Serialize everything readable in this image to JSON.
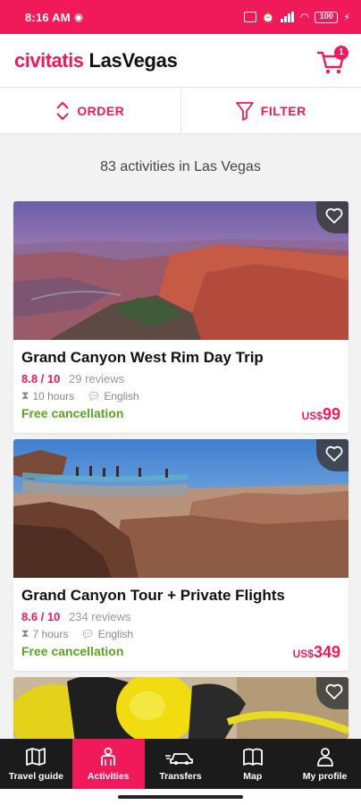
{
  "status_bar": {
    "time": "8:16 AM",
    "battery": "100"
  },
  "header": {
    "logo": "civitatis",
    "city": "LasVegas",
    "cart_count": "1"
  },
  "toolbar": {
    "order_label": "ORDER",
    "filter_label": "FILTER"
  },
  "results_count": "83 activities in Las Vegas",
  "activities": [
    {
      "title": "Grand Canyon West Rim Day Trip",
      "score": "8.8 / 10",
      "reviews": "29 reviews",
      "duration": "10 hours",
      "language": "English",
      "cancellation": "Free cancellation",
      "currency": "US$",
      "price": "99"
    },
    {
      "title": "Grand Canyon Tour + Private Flights",
      "score": "8.6 / 10",
      "reviews": "234 reviews",
      "duration": "7 hours",
      "language": "English",
      "cancellation": "Free cancellation",
      "currency": "US$",
      "price": "349"
    }
  ],
  "bottom_nav": [
    {
      "label": "Travel guide",
      "icon": "map-book-icon"
    },
    {
      "label": "Activities",
      "icon": "people-icon",
      "active": true
    },
    {
      "label": "Transfers",
      "icon": "car-transfer-icon"
    },
    {
      "label": "Map",
      "icon": "map-icon"
    },
    {
      "label": "My profile",
      "icon": "profile-icon"
    }
  ],
  "colors": {
    "brand": "#f0195a",
    "free": "#5ca51d",
    "nav_bg": "#1b1b1b"
  }
}
